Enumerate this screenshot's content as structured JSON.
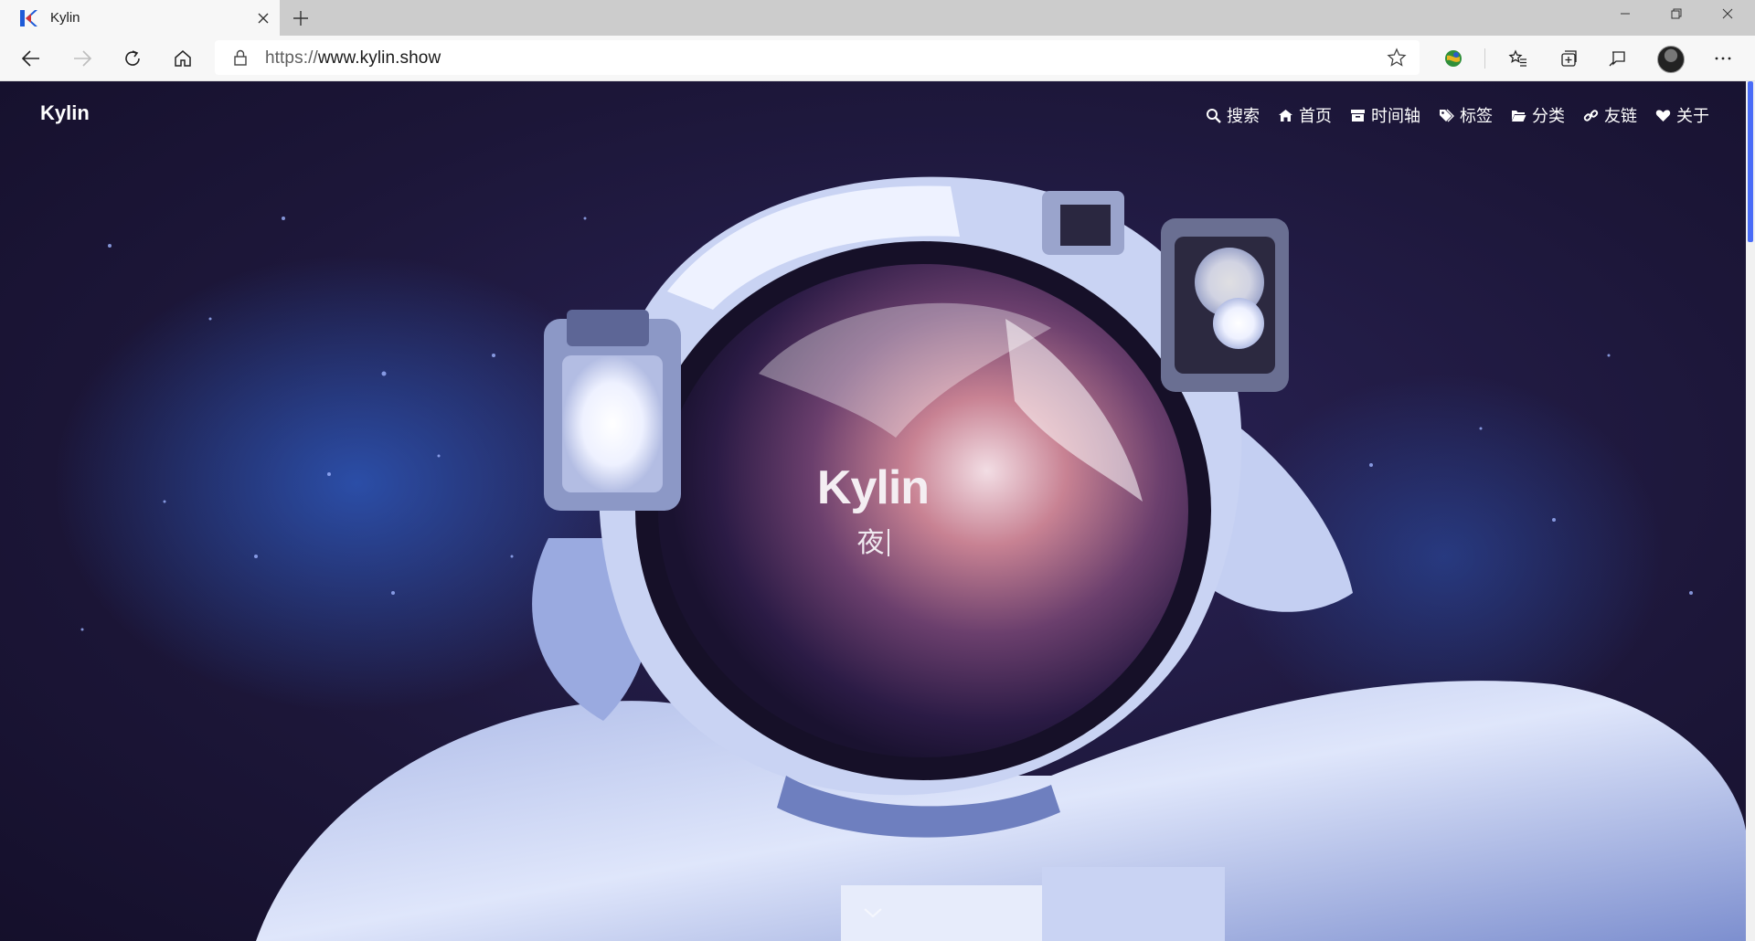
{
  "browser": {
    "tab": {
      "title": "Kylin"
    },
    "address": {
      "protocol": "https://",
      "host": "www.kylin.show"
    }
  },
  "site": {
    "brand": "Kylin",
    "nav": [
      {
        "label": "搜索",
        "icon": "search-icon"
      },
      {
        "label": "首页",
        "icon": "home-icon"
      },
      {
        "label": "时间轴",
        "icon": "archive-icon"
      },
      {
        "label": "标签",
        "icon": "tags-icon"
      },
      {
        "label": "分类",
        "icon": "folder-icon"
      },
      {
        "label": "友链",
        "icon": "link-icon"
      },
      {
        "label": "关于",
        "icon": "heart-icon"
      }
    ],
    "hero": {
      "title": "Kylin",
      "subtitle": "夜"
    }
  },
  "colors": {
    "background_deep": "#1b1535",
    "accent_scrollbar": "#4a6cf7",
    "brand_blue": "#1e5bd8"
  }
}
